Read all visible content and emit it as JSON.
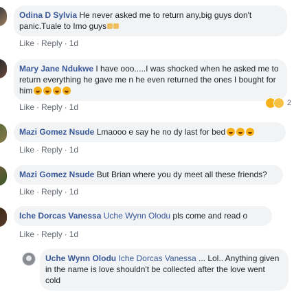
{
  "comments": [
    {
      "name": "Odina D Sylvia",
      "text": "He never asked me to return any,big guys don't panic.Tuale to Imo guys",
      "like": "Like",
      "reply": "Reply",
      "time": "1d"
    },
    {
      "name": "Mary Jane Ndukwe",
      "text": "I have ooo.....I was shocked when he asked me to return everything he gave me n he even returned the ones I bought for him",
      "like": "Like",
      "reply": "Reply",
      "time": "1d",
      "reaction_count": "2"
    },
    {
      "name": "Mazi Gomez Nsude",
      "text": "Lmaooo e say he no dy last for bed",
      "like": "Like",
      "reply": "Reply",
      "time": "1d"
    },
    {
      "name": "Mazi Gomez Nsude",
      "text": "But Brian where you dy meet all these friends?",
      "like": "Like",
      "reply": "Reply",
      "time": "1d"
    },
    {
      "name": "Iche Dorcas Vanessa",
      "tag": "Uche Wynn Olodu",
      "text": "pls come and read o",
      "like": "Like",
      "reply": "Reply",
      "time": "1d"
    }
  ],
  "reply": {
    "name": "Uche Wynn Olodu",
    "tag": "Iche Dorcas Vanessa",
    "text": "... Lol.. Anything given in the name is love shouldn't be collected after the love went cold"
  },
  "colors": {
    "name": "#385898",
    "bubble": "#f2f3f5",
    "meta": "#606770"
  }
}
